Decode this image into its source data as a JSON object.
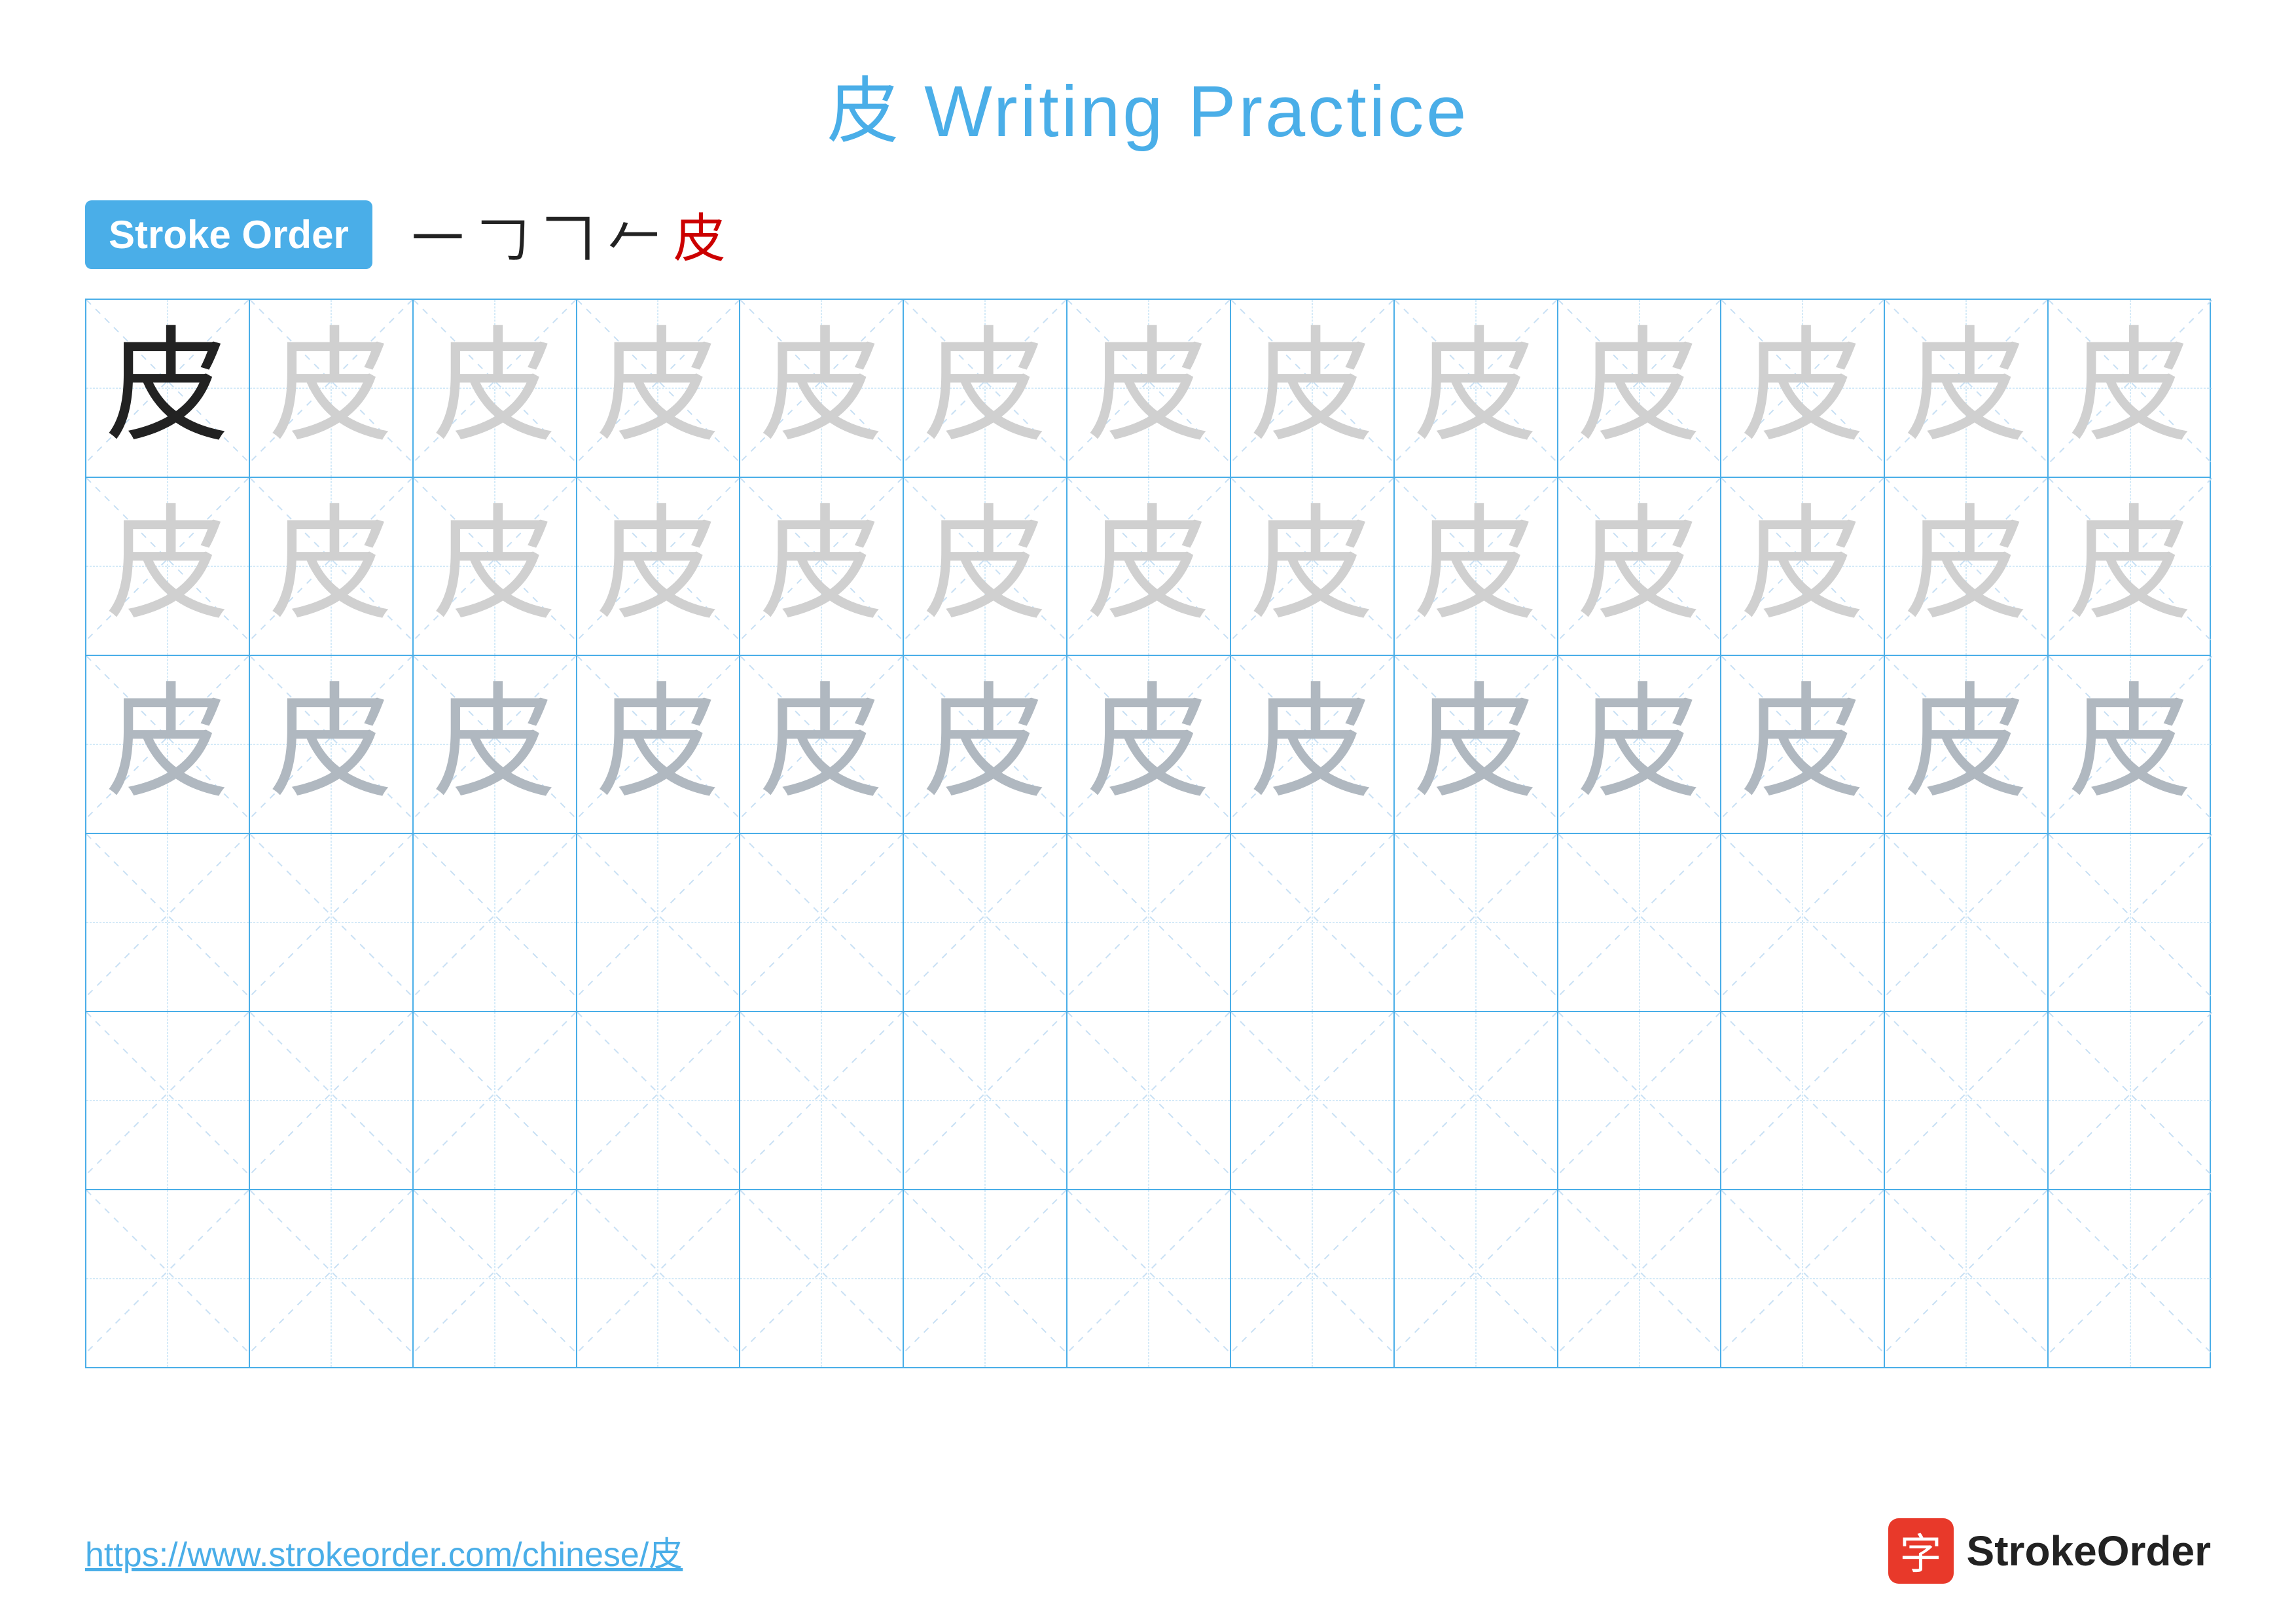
{
  "title": "皮 Writing Practice",
  "stroke_order": {
    "badge_label": "Stroke Order",
    "strokes": [
      "一",
      "𠃌",
      "𠃍𠂉",
      "𠂉𠃌𠃍",
      "皮"
    ]
  },
  "character": "皮",
  "grid": {
    "rows": 6,
    "cols": 13,
    "row_types": [
      "dark_first",
      "light",
      "lighter",
      "empty",
      "empty",
      "empty"
    ]
  },
  "footer": {
    "url": "https://www.strokeorder.com/chinese/皮",
    "logo_char": "字",
    "logo_text": "StrokeOrder"
  }
}
